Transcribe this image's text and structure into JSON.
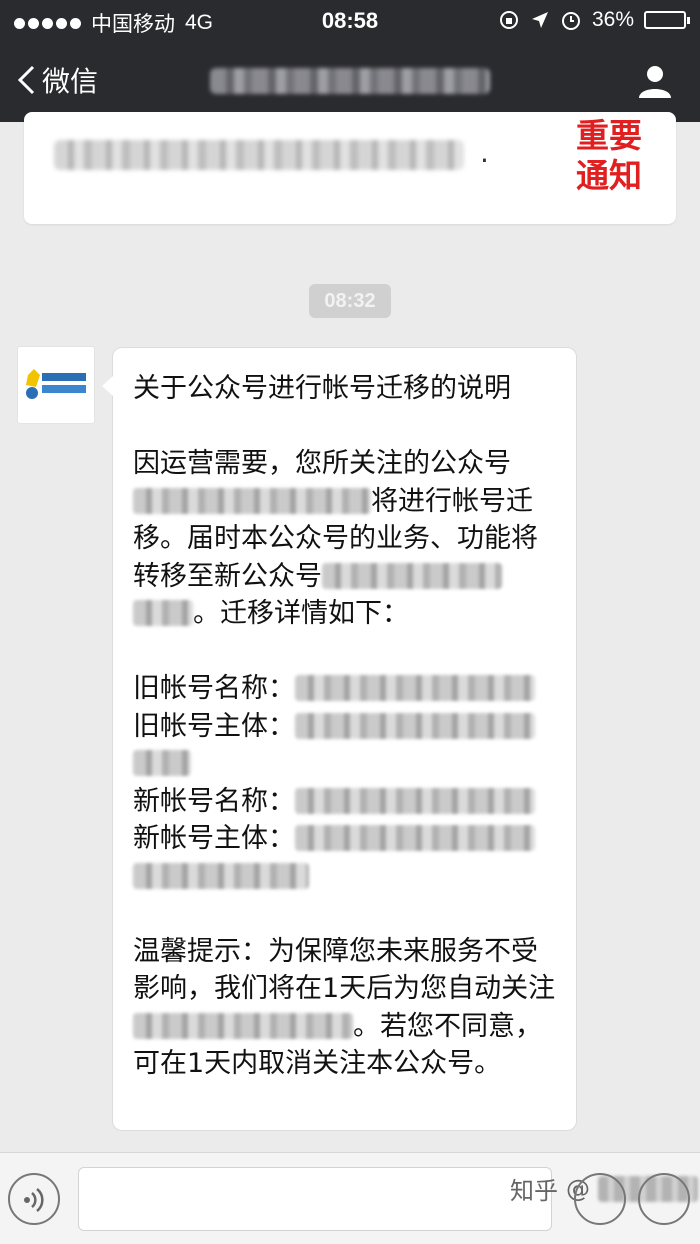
{
  "status_bar": {
    "carrier": "中国移动",
    "network": "4G",
    "time": "08:58",
    "battery": "36%",
    "battery_level": 0.36
  },
  "nav": {
    "back_label": "微信"
  },
  "top_card": {
    "period": ".",
    "notice_line1": "重要",
    "notice_line2": "通知"
  },
  "message_time": "08:32",
  "message": {
    "title": "关于公众号进行帐号迁移的说明",
    "p1_a": "因运营需要，您所关注的公众号",
    "p1_b": "将进行帐号迁",
    "p1_c": "移。届时本公众号的业务、功能将转移至新公众号",
    "p1_d": "。迁移详情如下：",
    "old_name_label": "旧帐号名称：",
    "old_owner_label": "旧帐号主体：",
    "new_name_label": "新帐号名称：",
    "new_owner_label": "新帐号主体：",
    "tip_a": "温馨提示：为保障您未来服务不受影响，我们将在1天后为您自动关注",
    "tip_b": "。若您不同意，可在1天内取消关注本公众号。"
  },
  "watermark": {
    "site": "知乎",
    "at": "@"
  },
  "colors": {
    "nav_bg": "#2a2b2f",
    "chat_bg": "#ebebeb",
    "notice_red": "#e02020"
  }
}
